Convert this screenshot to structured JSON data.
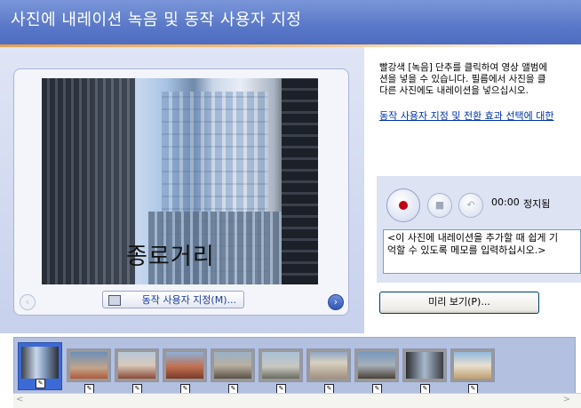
{
  "header": {
    "title": "사진에 내레이션 녹음 및 동작 사용자 지정"
  },
  "preview": {
    "caption": "종로거리",
    "motion_button_label": "동작 사용자 지정(M)...",
    "nav_prev_glyph": "‹",
    "nav_next_glyph": "›"
  },
  "instructions": {
    "text": "빨강색 [녹음] 단추를 클릭하여 영상 앨범에\n션을 넣을 수 있습니다. 필름에서 사진을 클\n다른 사진에도 내레이션을 넣으십시오.",
    "link": "동작 사용자 지정 및 전환 효과 선택에 대한"
  },
  "recorder": {
    "time": "00:00",
    "status": "정지됨",
    "stop_glyph": "■",
    "undo_glyph": "↶"
  },
  "note": {
    "text": "<이 사진에 내레이션을 추가할 때 쉽게 기\n억할 수 있도록 메모를 입력하십시오.>"
  },
  "preview_button_label": "미리 보기(P)...",
  "filmstrip": {
    "thumbs": [
      "thumb-1",
      "thumb-2",
      "thumb-3",
      "thumb-4",
      "thumb-5",
      "thumb-6",
      "thumb-7",
      "thumb-8",
      "thumb-9",
      "thumb-10"
    ],
    "selected_index": 0,
    "edit_glyph": "✎"
  },
  "scrollbar": {
    "left_glyph": "<",
    "right_glyph": ">"
  }
}
